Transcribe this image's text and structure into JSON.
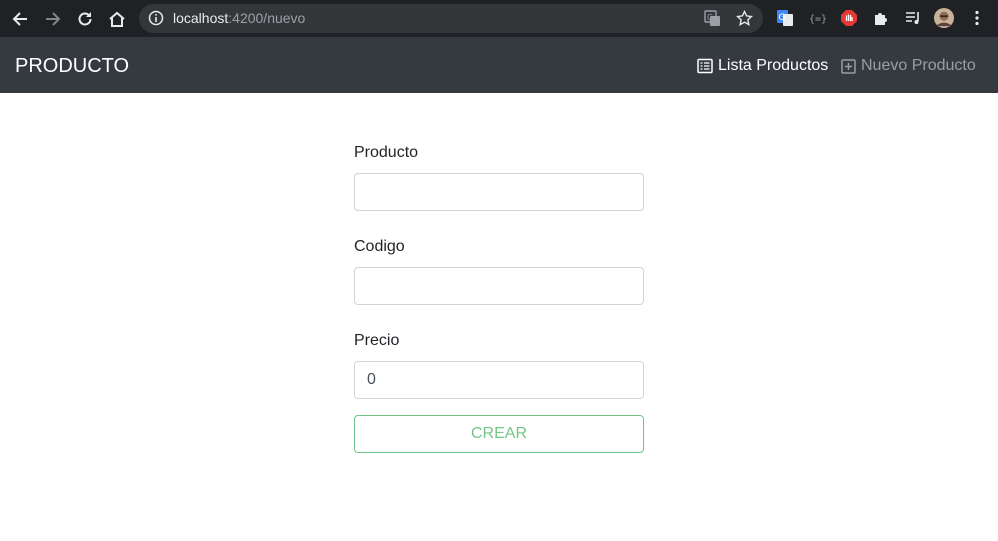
{
  "browser": {
    "url_host": "localhost",
    "url_path": ":4200/nuevo",
    "icons": {
      "back": "back-arrow-icon",
      "forward": "forward-arrow-icon",
      "reload": "reload-icon",
      "home": "home-icon",
      "info": "info-icon",
      "translate": "translate-icon",
      "bookmark": "star-icon",
      "extensions": [
        "google-translate-extension-icon",
        "json-extension-icon",
        "adblock-icon",
        "puzzle-icon",
        "media-queue-icon",
        "profile-avatar",
        "kebab-menu-icon"
      ]
    }
  },
  "navbar": {
    "brand": "PRODUCTO",
    "links": [
      {
        "label": "Lista Productos",
        "icon": "list-icon",
        "active": true
      },
      {
        "label": "Nuevo Producto",
        "icon": "plus-square-icon",
        "active": false
      }
    ],
    "background": "#343a40"
  },
  "form": {
    "fields": [
      {
        "label": "Producto",
        "value": ""
      },
      {
        "label": "Codigo",
        "value": ""
      },
      {
        "label": "Precio",
        "value": "0"
      }
    ],
    "submit_label": "CREAR",
    "submit_color": "#28a745"
  }
}
